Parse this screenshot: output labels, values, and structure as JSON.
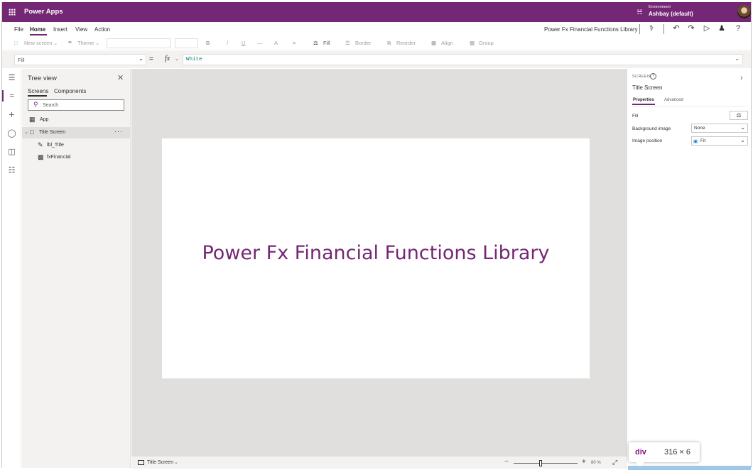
{
  "header": {
    "app_name": "Power Apps",
    "environment_label": "Environment",
    "environment_name": "Ashbay (default)",
    "brand_color": "#742774"
  },
  "menu": {
    "items": [
      "File",
      "Home",
      "Insert",
      "View",
      "Action"
    ],
    "active": "Home",
    "document_title": "Power Fx Financial Functions Library"
  },
  "ribbon": {
    "new_screen": "New screen",
    "theme": "Theme",
    "bold": "B",
    "italic": "/",
    "underline": "U",
    "strike": "—",
    "font_color": "A",
    "align_text": "≡",
    "fill": "Fill",
    "border": "Border",
    "reorder": "Reorder",
    "align": "Align",
    "group": "Group"
  },
  "formula_bar": {
    "property": "Fill",
    "equals": "=",
    "fx": "fx",
    "formula": "White"
  },
  "tree_view": {
    "title": "Tree view",
    "tabs": [
      "Screens",
      "Components"
    ],
    "active_tab": "Screens",
    "search_placeholder": "Search",
    "items": [
      {
        "label": "App",
        "icon": "app-icon"
      },
      {
        "label": "Title Screen",
        "icon": "screen-icon",
        "selected": true
      },
      {
        "label": "lbl_Title",
        "icon": "label-icon"
      },
      {
        "label": "fxFinancial",
        "icon": "component-icon"
      }
    ]
  },
  "canvas": {
    "title_text": "Power Fx Financial Functions Library",
    "title_color": "#742774"
  },
  "status_bar": {
    "screen": "Title Screen",
    "zoom": "80 %",
    "zoom_minus": "−",
    "zoom_plus": "+"
  },
  "properties": {
    "kind": "SCREEN",
    "name": "Title Screen",
    "tabs": [
      "Properties",
      "Advanced"
    ],
    "active_tab": "Properties",
    "fill_label": "Fill",
    "background_image_label": "Background image",
    "background_image_value": "None",
    "image_position_label": "Image position",
    "image_position_value": "Fit"
  },
  "inspect_tooltip": {
    "tag": "div",
    "size": "316 × 6"
  }
}
